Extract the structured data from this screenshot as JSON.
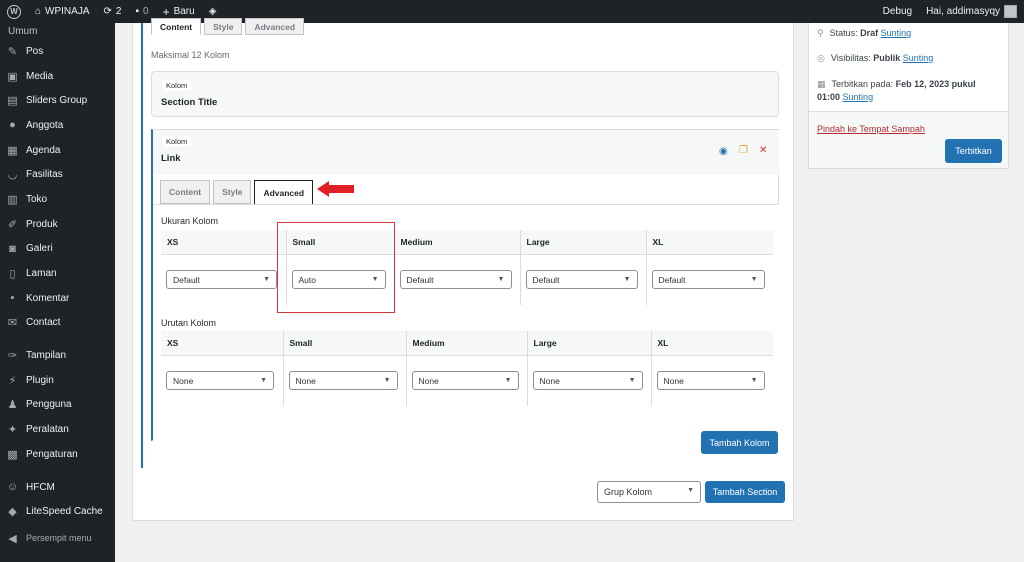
{
  "admin_bar": {
    "site_name": "WPINAJA",
    "updates_count": "2",
    "comments_count": "0",
    "new_label": "Baru",
    "debug_label": "Debug",
    "greeting": "Hai, addimasyqy"
  },
  "sidebar": {
    "sub_item": "Umum",
    "items": [
      {
        "label": "Pos",
        "icon": "pin-icon"
      },
      {
        "label": "Media",
        "icon": "media-icon"
      },
      {
        "label": "Sliders Group",
        "icon": "sliders-icon"
      },
      {
        "label": "Anggota",
        "icon": "user-icon"
      },
      {
        "label": "Agenda",
        "icon": "calendar-icon"
      },
      {
        "label": "Fasilitas",
        "icon": "smile-icon"
      },
      {
        "label": "Toko",
        "icon": "store-icon"
      },
      {
        "label": "Produk",
        "icon": "product-icon"
      },
      {
        "label": "Galeri",
        "icon": "camera-icon"
      },
      {
        "label": "Laman",
        "icon": "page-icon"
      },
      {
        "label": "Komentar",
        "icon": "comment-icon"
      },
      {
        "label": "Contact",
        "icon": "mail-icon"
      },
      {
        "label": "Tampilan",
        "icon": "brush-icon"
      },
      {
        "label": "Plugin",
        "icon": "plugin-icon"
      },
      {
        "label": "Pengguna",
        "icon": "users-icon"
      },
      {
        "label": "Peralatan",
        "icon": "wrench-icon"
      },
      {
        "label": "Pengaturan",
        "icon": "settings-icon"
      },
      {
        "label": "HFCM",
        "icon": "robot-icon"
      },
      {
        "label": "LiteSpeed Cache",
        "icon": "litespeed-icon"
      }
    ],
    "collapse_label": "Persempit menu"
  },
  "editor": {
    "top_tabs": [
      "Content",
      "Style",
      "Advanced"
    ],
    "max_note": "Maksimal 12 Kolom",
    "section_title_card": {
      "pill": "Kolom",
      "title": "Section Title"
    },
    "link_card": {
      "pill": "Kolom",
      "title": "Link"
    },
    "link_tabs": [
      "Content",
      "Style",
      "Advanced"
    ],
    "ukuran": {
      "label": "Ukuran Kolom",
      "headers": [
        "XS",
        "Small",
        "Medium",
        "Large",
        "XL"
      ],
      "values": [
        "Default",
        "Auto",
        "Default",
        "Default",
        "Default"
      ]
    },
    "urutan": {
      "label": "Urutan Kolom",
      "headers": [
        "XS",
        "Small",
        "Medium",
        "Large",
        "XL"
      ],
      "values": [
        "None",
        "None",
        "None",
        "None",
        "None"
      ]
    },
    "add_column_label": "Tambah Kolom",
    "group_select_value": "Grup Kolom",
    "add_section_label": "Tambah Section"
  },
  "publish": {
    "status_label": "Status:",
    "status_value": "Draf",
    "visibility_label": "Visibilitas:",
    "visibility_value": "Publik",
    "edit_label": "Sunting",
    "publish_on_label": "Terbitkan pada:",
    "publish_date": "Feb 12, 2023 pukul",
    "publish_time": "01:00",
    "trash_label": "Pindah ke Tempat Sampah",
    "publish_button": "Terbitkan"
  }
}
